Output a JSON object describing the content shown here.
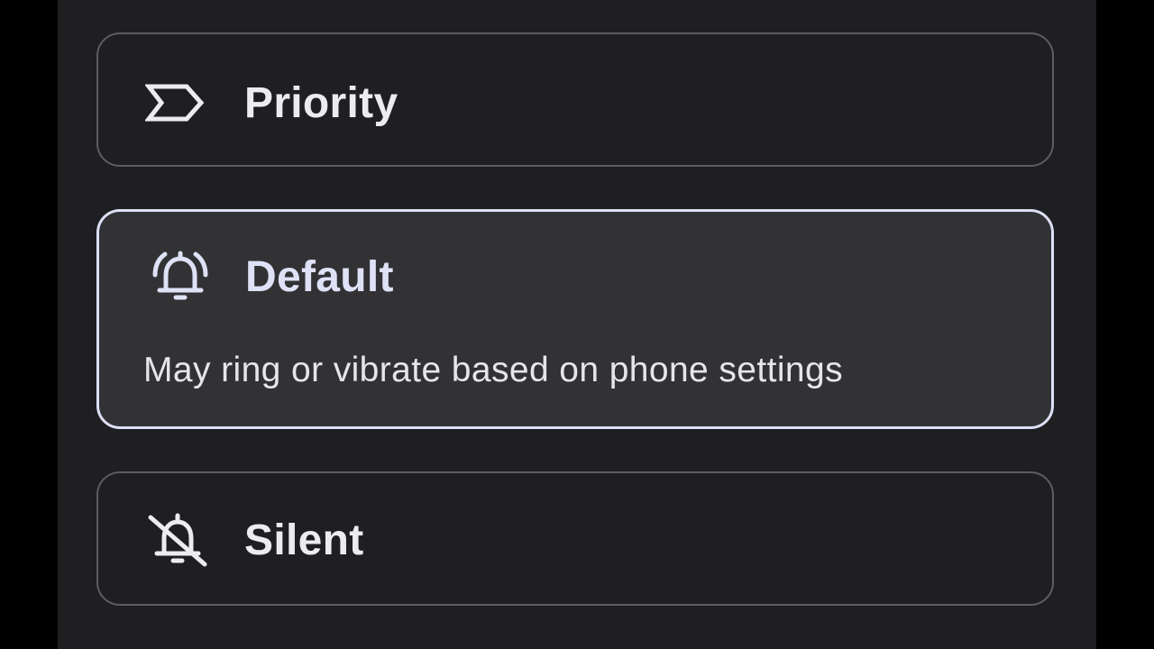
{
  "options": [
    {
      "icon": "priority-icon",
      "label": "Priority",
      "selected": false
    },
    {
      "icon": "bell-ringing-icon",
      "label": "Default",
      "description": "May ring or vibrate based on phone settings",
      "selected": true
    },
    {
      "icon": "bell-off-icon",
      "label": "Silent",
      "selected": false
    }
  ],
  "colors": {
    "panel_background": "#1f1f21",
    "selected_background": "#323235",
    "selected_border": "#dde0f5",
    "unselected_border": "#5d5d62",
    "text": "#ececef"
  }
}
